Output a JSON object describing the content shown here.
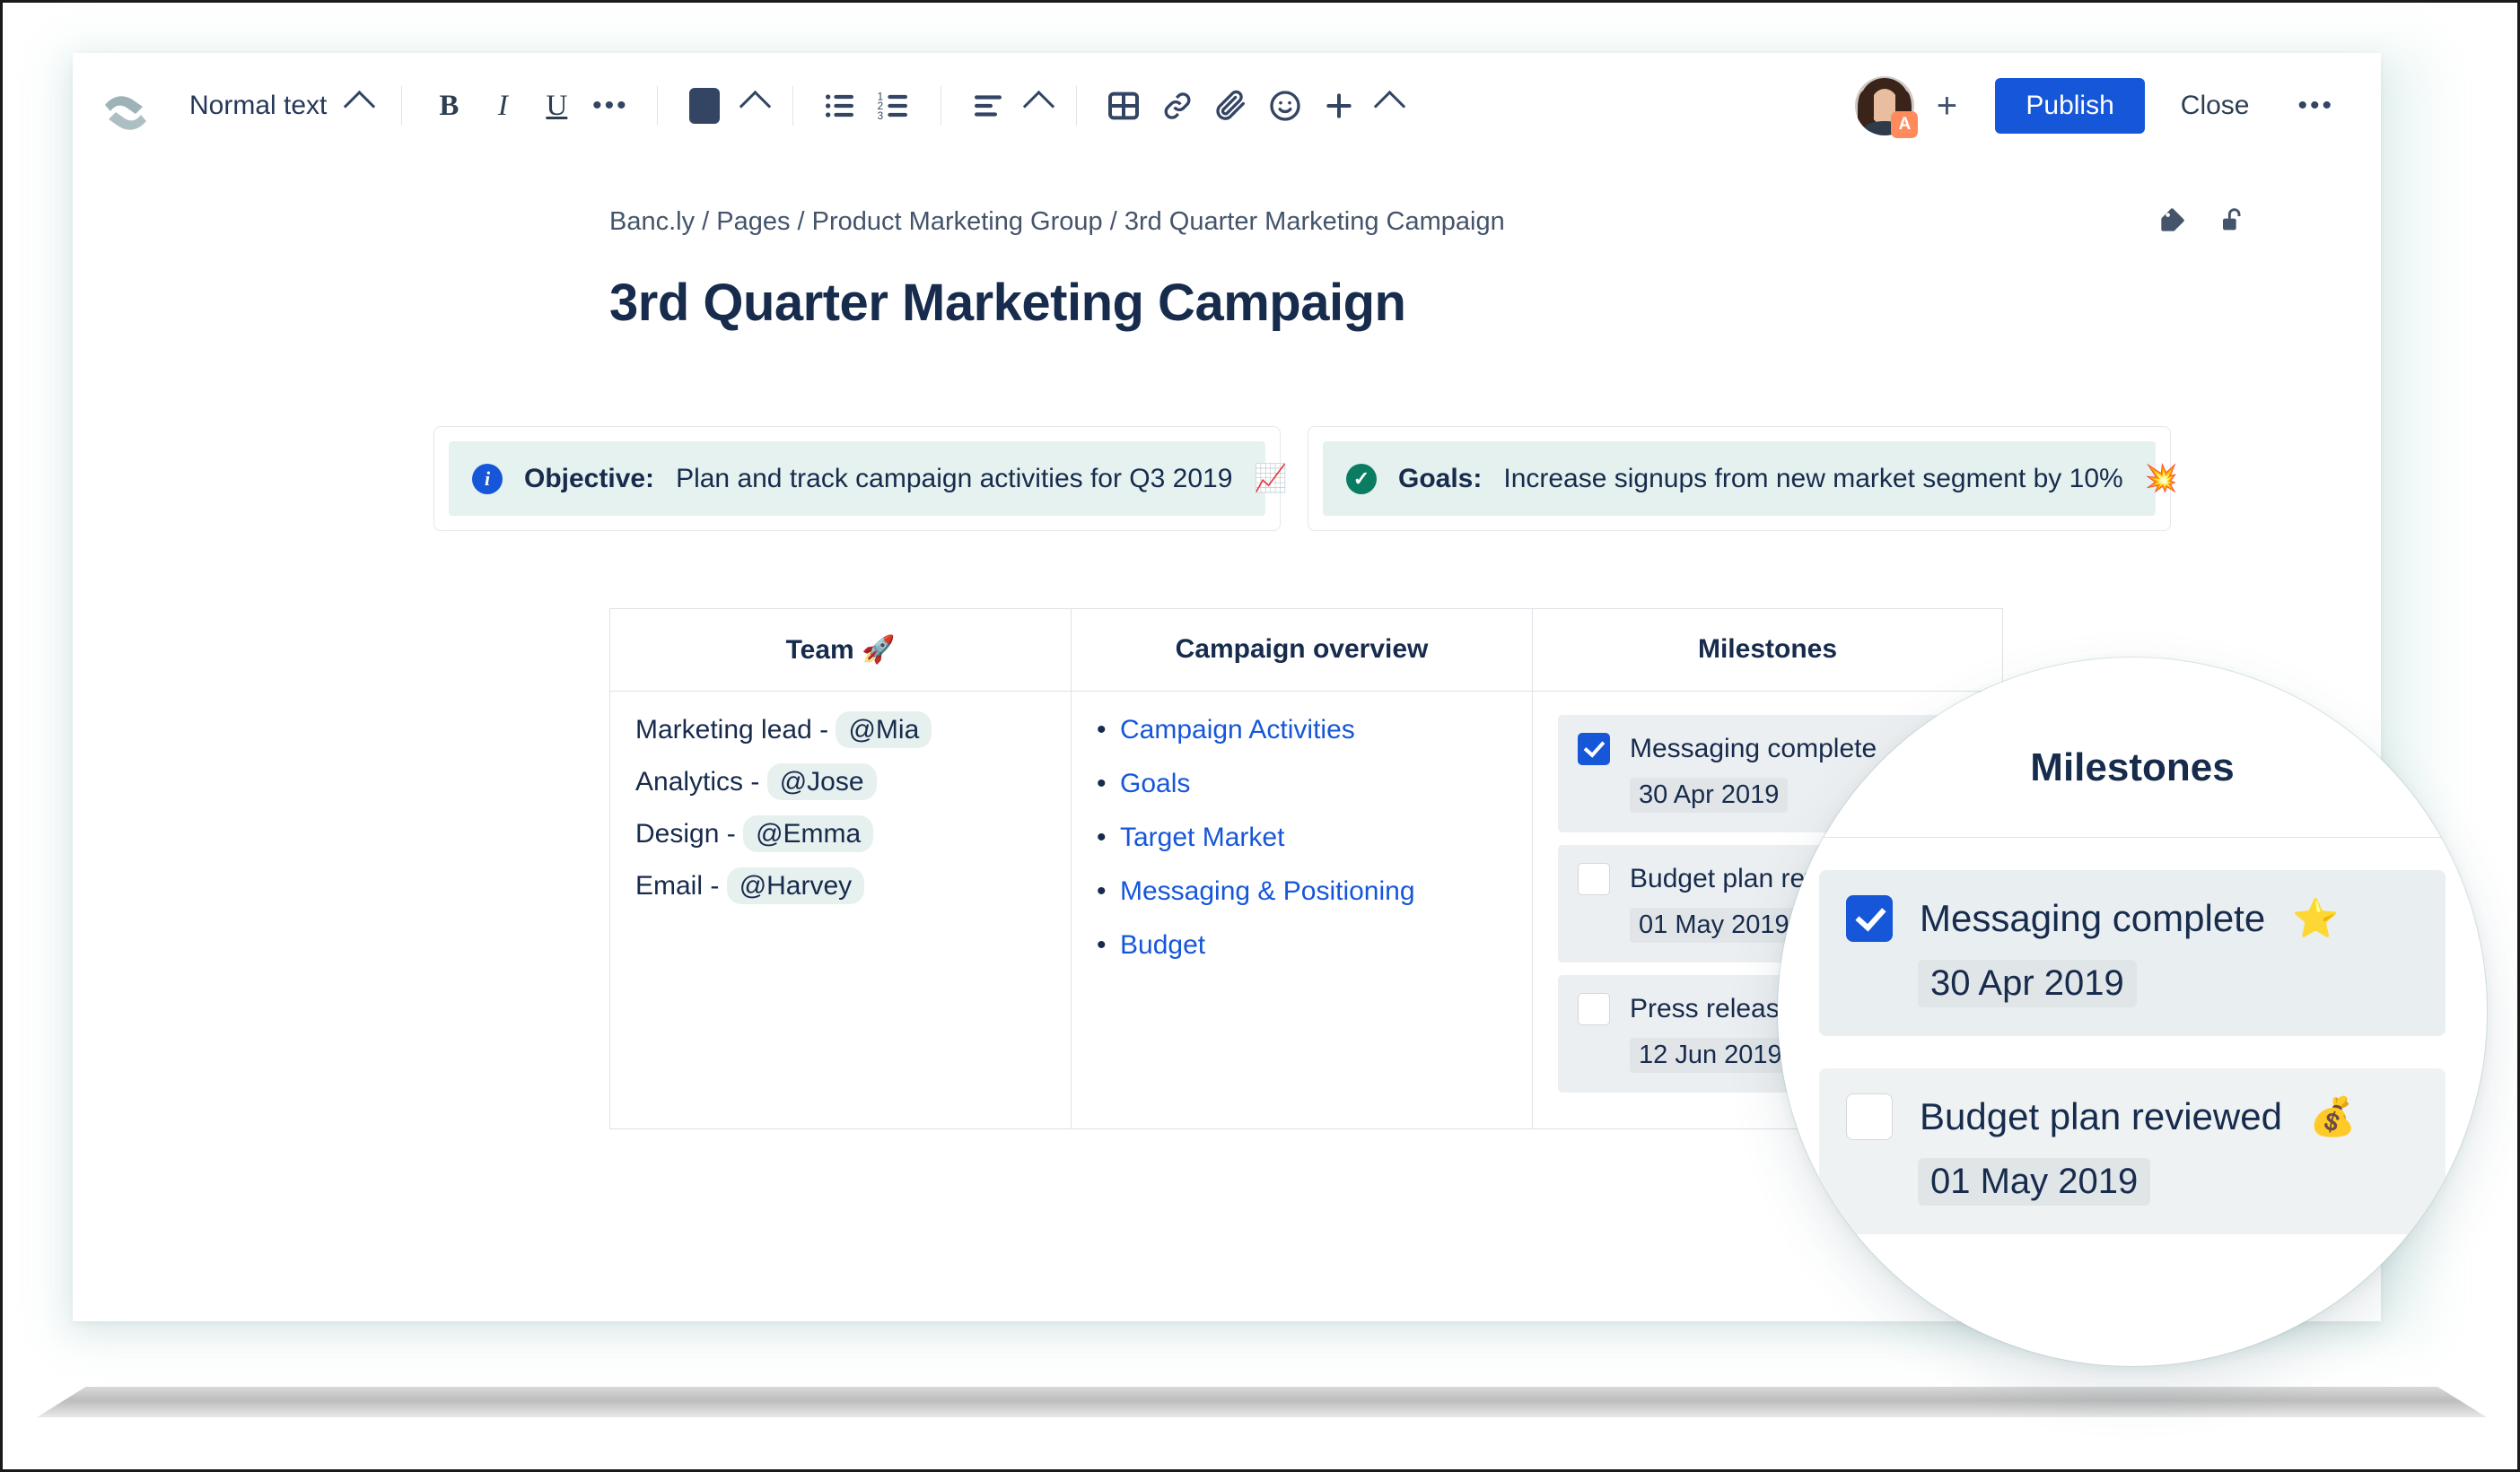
{
  "toolbar": {
    "logo_name": "confluence-logo",
    "style_selector": "Normal text",
    "bold_label": "B",
    "italic_label": "I",
    "underline_label": "U",
    "more_formatting_label": "…",
    "text_color_label": "",
    "bullet_list_label": "",
    "numbered_list_label": "",
    "align_label": "",
    "table_label": "",
    "link_label": "",
    "attachment_label": "",
    "emoji_label": "",
    "insert_label": "+",
    "avatar_badge": "A",
    "add_person_label": "+",
    "publish_label": "Publish",
    "close_label": "Close",
    "more_actions_label": "…"
  },
  "page": {
    "breadcrumb": "Banc.ly / Pages / Product Marketing Group / 3rd Quarter Marketing Campaign",
    "title": "3rd Quarter Marketing Campaign",
    "tag_action": "tag-icon",
    "restrictions_action": "unlock-icon"
  },
  "panels": [
    {
      "icon": "info-icon",
      "icon_glyph": "i",
      "label": "Objective:",
      "text": "Plan and track campaign activities for Q3 2019",
      "emoji": "📈"
    },
    {
      "icon": "success-check-icon",
      "icon_glyph": "✓",
      "label": "Goals:",
      "text": "Increase signups from new market segment by 10%",
      "emoji": "💥"
    }
  ],
  "table": {
    "headers": [
      {
        "label": "Team",
        "emoji": "🚀"
      },
      {
        "label": "Campaign overview",
        "emoji": ""
      },
      {
        "label": "Milestones",
        "emoji": ""
      }
    ],
    "team": [
      {
        "role": "Marketing lead -",
        "mention": "@Mia"
      },
      {
        "role": "Analytics -",
        "mention": "@Jose"
      },
      {
        "role": "Design -",
        "mention": "@Emma"
      },
      {
        "role": "Email -",
        "mention": "@Harvey"
      }
    ],
    "campaign_overview": [
      "Campaign Activities",
      "Goals",
      "Target Market",
      "Messaging & Positioning",
      "Budget"
    ],
    "milestones": [
      {
        "checked": true,
        "title": "Messaging complete",
        "date": "30 Apr 2019"
      },
      {
        "checked": false,
        "title": "Budget plan reviewed",
        "date": "01 May 2019"
      },
      {
        "checked": false,
        "title": "Press release drafted",
        "date": "12 Jun 2019"
      }
    ]
  },
  "magnifier": {
    "title": "Milestones",
    "items": [
      {
        "checked": true,
        "title": "Messaging complete",
        "emoji": "⭐",
        "date": "30 Apr 2019"
      },
      {
        "checked": false,
        "title": "Budget plan reviewed",
        "emoji": "💰",
        "date": "01 May 2019"
      }
    ]
  },
  "colors": {
    "accent_blue": "#1656d9",
    "success_green": "#0a7c62",
    "text_dark": "#172b4d",
    "panel_mint": "#e6f2f0",
    "badge_orange": "#ff8b5c"
  }
}
